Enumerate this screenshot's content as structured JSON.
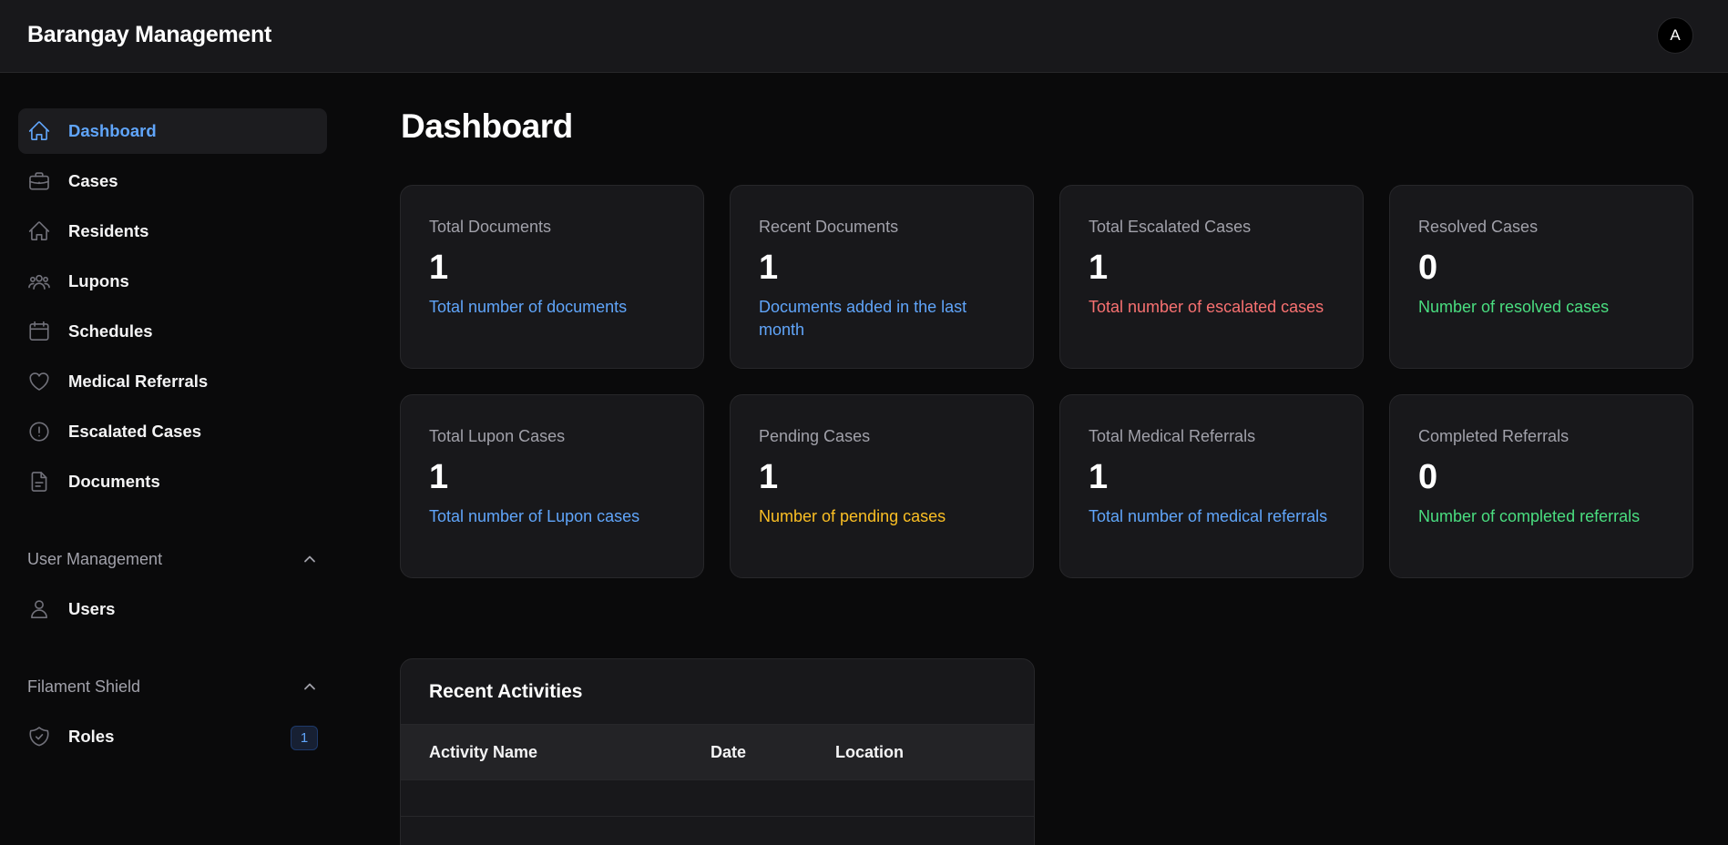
{
  "app": {
    "title": "Barangay Management",
    "avatar_initial": "A"
  },
  "sidebar": {
    "items": [
      {
        "label": "Dashboard",
        "icon": "home-icon",
        "active": true
      },
      {
        "label": "Cases",
        "icon": "briefcase-icon"
      },
      {
        "label": "Residents",
        "icon": "home-icon"
      },
      {
        "label": "Lupons",
        "icon": "user-group-icon"
      },
      {
        "label": "Schedules",
        "icon": "calendar-icon"
      },
      {
        "label": "Medical Referrals",
        "icon": "heart-icon"
      },
      {
        "label": "Escalated Cases",
        "icon": "exclamation-circle-icon"
      },
      {
        "label": "Documents",
        "icon": "document-text-icon"
      }
    ],
    "groups": [
      {
        "title": "User Management",
        "items": [
          {
            "label": "Users",
            "icon": "user-icon"
          }
        ]
      },
      {
        "title": "Filament Shield",
        "items": [
          {
            "label": "Roles",
            "icon": "shield-check-icon",
            "badge": "1"
          }
        ]
      }
    ]
  },
  "main": {
    "title": "Dashboard",
    "stats": [
      {
        "title": "Total Documents",
        "value": "1",
        "description": "Total number of documents",
        "color": "#60a5fa"
      },
      {
        "title": "Recent Documents",
        "value": "1",
        "description": "Documents added in the last month",
        "color": "#60a5fa"
      },
      {
        "title": "Total Escalated Cases",
        "value": "1",
        "description": "Total number of escalated cases",
        "color": "#f87171"
      },
      {
        "title": "Resolved Cases",
        "value": "0",
        "description": "Number of resolved cases",
        "color": "#4ade80"
      },
      {
        "title": "Total Lupon Cases",
        "value": "1",
        "description": "Total number of Lupon cases",
        "color": "#60a5fa"
      },
      {
        "title": "Pending Cases",
        "value": "1",
        "description": "Number of pending cases",
        "color": "#fbbf24"
      },
      {
        "title": "Total Medical Referrals",
        "value": "1",
        "description": "Total number of medical referrals",
        "color": "#60a5fa"
      },
      {
        "title": "Completed Referrals",
        "value": "0",
        "description": "Number of completed referrals",
        "color": "#4ade80"
      }
    ],
    "recent_activities": {
      "title": "Recent Activities",
      "columns": [
        "Activity Name",
        "Date",
        "Location"
      ],
      "rows": []
    }
  }
}
